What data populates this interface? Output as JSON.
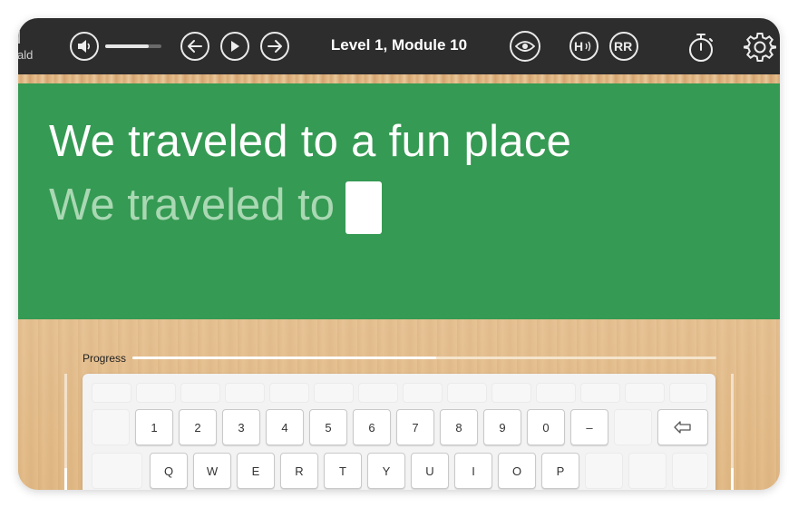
{
  "app": {
    "partial_label": "ald",
    "module_title": "Level 1, Module 10",
    "volume_level": 0.78,
    "icons": {
      "volume": "speaker-icon",
      "back": "arrow-left-icon",
      "play": "play-icon",
      "forward": "arrow-right-icon",
      "view": "eye-icon",
      "hint": "h-sound-icon",
      "repeat": "rr-icon",
      "timer": "stopwatch-icon",
      "settings": "gear-icon"
    }
  },
  "board": {
    "target_sentence": "We traveled to a fun place",
    "typed_text": "We traveled to"
  },
  "progress": {
    "label": "Progress",
    "value": 0.52
  },
  "keyboard": {
    "number_row": [
      "1",
      "2",
      "3",
      "4",
      "5",
      "6",
      "7",
      "8",
      "9",
      "0",
      "–"
    ],
    "backspace_icon": "backspace-arrow-icon",
    "letter_row": [
      "Q",
      "W",
      "E",
      "R",
      "T",
      "Y",
      "U",
      "I",
      "O",
      "P"
    ]
  },
  "colors": {
    "board_green": "#359a53",
    "typed_text": "#a9d8b3",
    "topbar": "#2d2d2d",
    "key_dot": "#f3b53f"
  }
}
